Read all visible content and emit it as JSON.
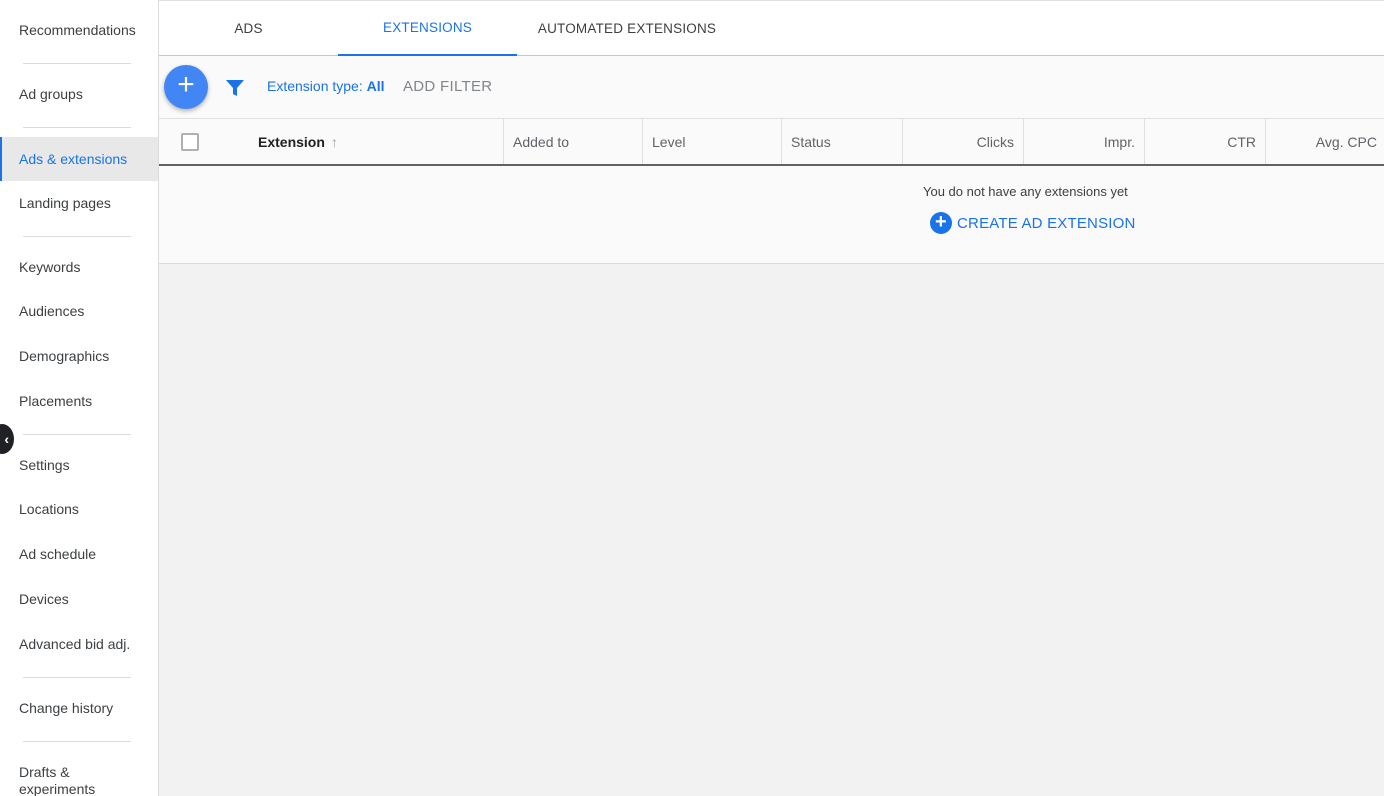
{
  "sidebar": {
    "items": [
      {
        "label": "Recommendations"
      },
      {
        "label": "Ad groups"
      },
      {
        "label": "Ads & extensions",
        "active": true
      },
      {
        "label": "Landing pages"
      },
      {
        "label": "Keywords"
      },
      {
        "label": "Audiences"
      },
      {
        "label": "Demographics"
      },
      {
        "label": "Placements"
      },
      {
        "label": "Settings"
      },
      {
        "label": "Locations"
      },
      {
        "label": "Ad schedule"
      },
      {
        "label": "Devices"
      },
      {
        "label": "Advanced bid adj."
      },
      {
        "label": "Change history"
      },
      {
        "label_line1": "Drafts &",
        "label_line2": "experiments"
      }
    ],
    "collapse_glyph": "‹"
  },
  "tabs": [
    {
      "label": "ADS"
    },
    {
      "label": "EXTENSIONS",
      "active": true
    },
    {
      "label": "AUTOMATED EXTENSIONS"
    }
  ],
  "toolbar": {
    "fab_glyph": "+",
    "filter_prefix": "Extension type: ",
    "filter_value": "All",
    "add_filter": "ADD FILTER"
  },
  "table": {
    "columns": [
      "Extension",
      "Added to",
      "Level",
      "Status",
      "Clicks",
      "Impr.",
      "CTR",
      "Avg. CPC"
    ],
    "sort_glyph": "↑"
  },
  "empty_state": {
    "message": "You do not have any extensions yet",
    "action": "CREATE AD EXTENSION",
    "action_glyph": "+"
  },
  "colors": {
    "accent": "#1a73e8",
    "fab": "#4285f4"
  }
}
